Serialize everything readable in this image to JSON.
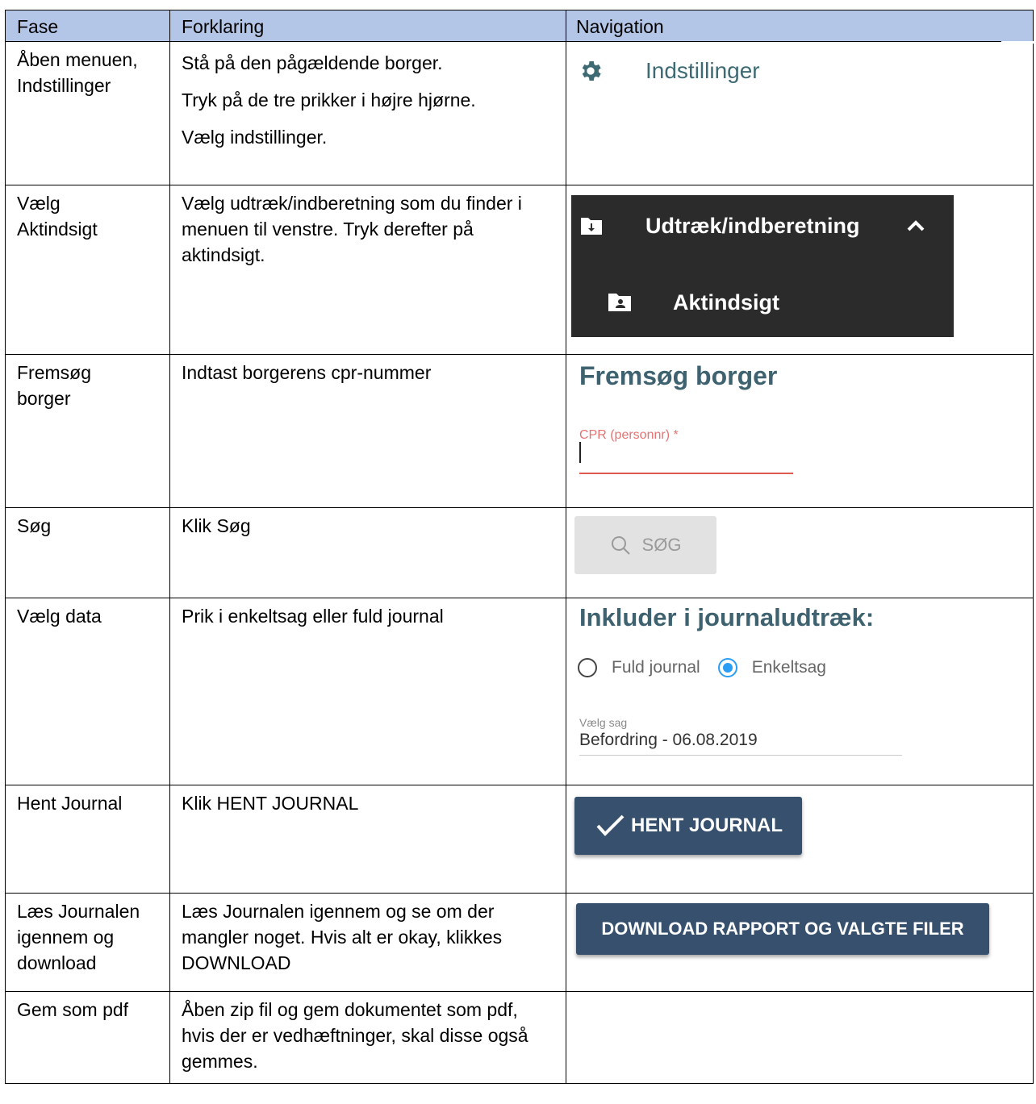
{
  "header": {
    "col1": "Fase",
    "col2": "Forklaring",
    "col3": "Navigation"
  },
  "rows": [
    {
      "fase": "Åben menuen, Indstillinger",
      "forklaring": [
        "Stå på den pågældende borger.",
        "Tryk på de tre prikker i højre hjørne.",
        "Vælg indstillinger."
      ],
      "nav": {
        "label": "Indstillinger",
        "icon": "gear-icon"
      }
    },
    {
      "fase": "Vælg Aktindsigt",
      "forklaring": [
        "Vælg udtræk/indberetning som du finder i menuen til venstre. Tryk derefter på aktindsigt."
      ],
      "nav": {
        "menu_label": "Udtræk/indberetning",
        "sub_label": "Aktindsigt"
      }
    },
    {
      "fase": "Fremsøg borger",
      "forklaring": [
        "Indtast borgerens cpr-nummer"
      ],
      "nav": {
        "title": "Fremsøg borger",
        "field_label": "CPR (personnr) *"
      }
    },
    {
      "fase": "Søg",
      "forklaring": [
        "Klik Søg"
      ],
      "nav": {
        "button_label": "SØG"
      }
    },
    {
      "fase": "Vælg data",
      "forklaring": [
        "Prik i enkeltsag eller fuld journal"
      ],
      "nav": {
        "title": "Inkluder i journaludtræk:",
        "option1": "Fuld journal",
        "option2": "Enkeltsag",
        "selected": "Enkeltsag",
        "select_label": "Vælg sag",
        "select_value": "Befordring - 06.08.2019"
      }
    },
    {
      "fase": "Hent Journal",
      "forklaring": [
        "Klik HENT JOURNAL"
      ],
      "nav": {
        "button_label": "HENT JOURNAL"
      }
    },
    {
      "fase": "Læs Journalen igennem og download",
      "forklaring": [
        "Læs Journalen igennem og se om der mangler noget. Hvis alt er okay, klikkes DOWNLOAD"
      ],
      "nav": {
        "button_label": "DOWNLOAD RAPPORT OG VALGTE FILER"
      }
    },
    {
      "fase": "Gem som pdf",
      "forklaring": [
        "Åben zip fil og gem dokumentet som pdf, hvis der er vedhæftninger, skal disse også gemmes."
      ],
      "nav": {}
    }
  ],
  "colors": {
    "header_bg": "#b4c6e7",
    "button_bg": "#36506e",
    "accent_blue": "#2a9df4",
    "error_red": "#e05a50"
  }
}
